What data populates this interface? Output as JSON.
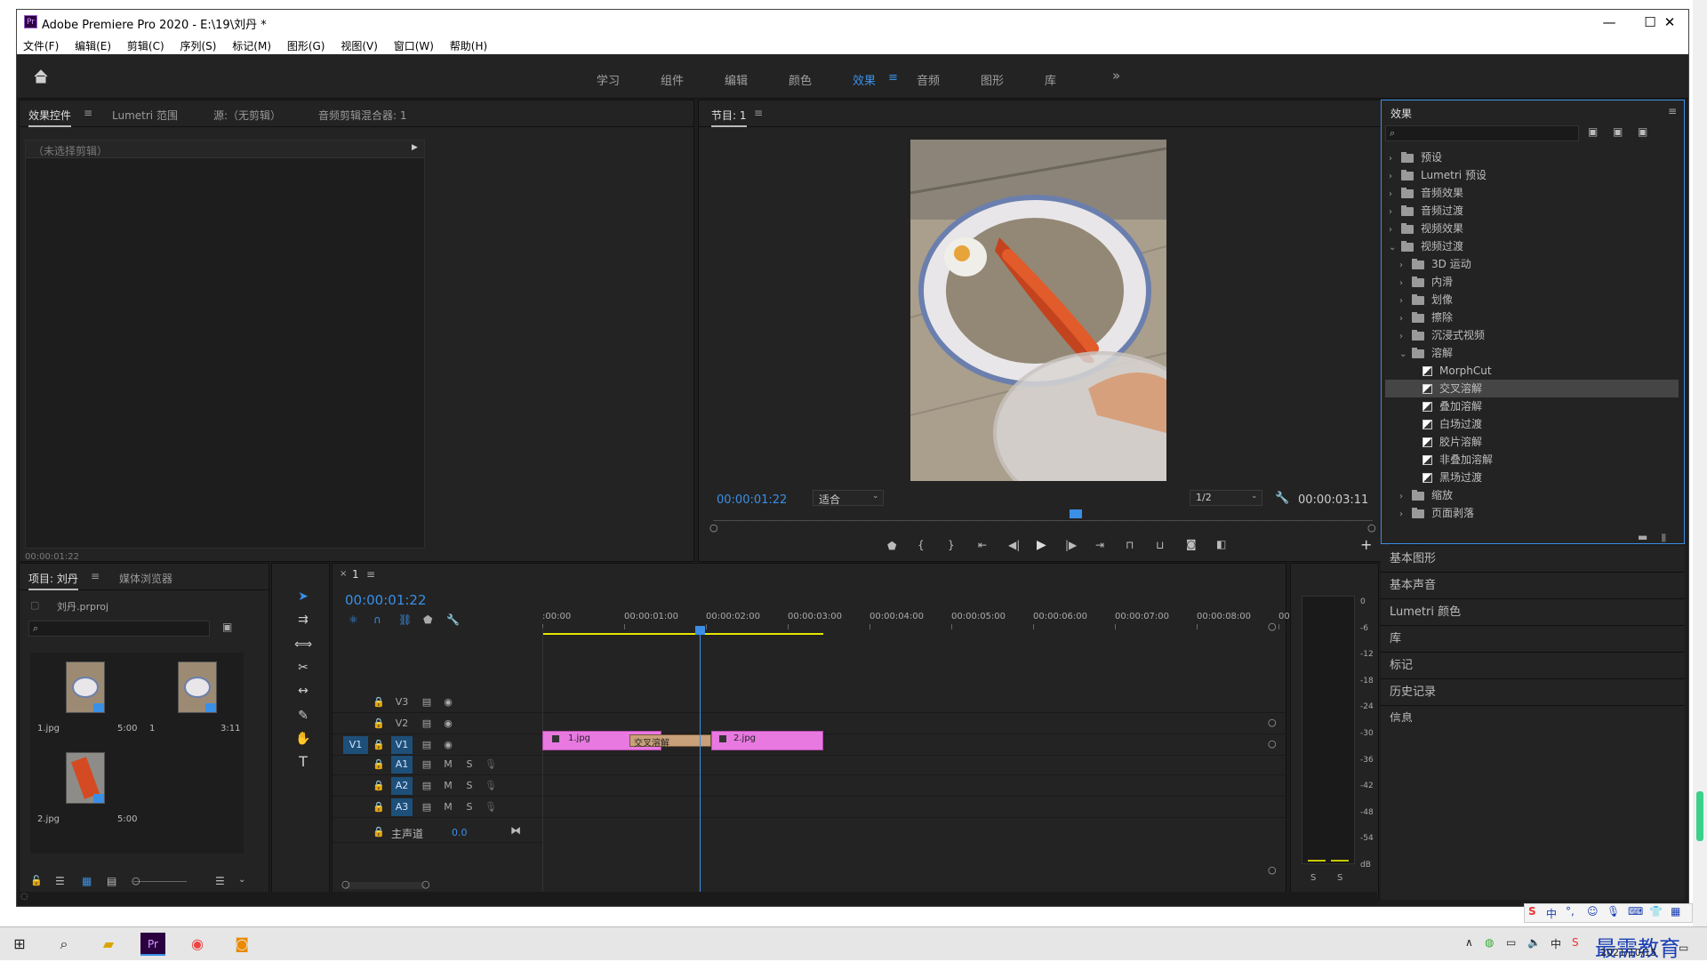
{
  "window": {
    "title": "Adobe Premiere Pro 2020 - E:\\19\\刘丹 *",
    "logo": "Pr",
    "controls": {
      "minimize": "—",
      "maximize": "☐",
      "close": "✕"
    }
  },
  "menu": [
    "文件(F)",
    "编辑(E)",
    "剪辑(C)",
    "序列(S)",
    "标记(M)",
    "图形(G)",
    "视图(V)",
    "窗口(W)",
    "帮助(H)"
  ],
  "workspaces": {
    "items": [
      "学习",
      "组件",
      "编辑",
      "颜色",
      "效果",
      "音频",
      "图形",
      "库"
    ],
    "active": "效果",
    "menu_icon": "≡",
    "overflow": "»"
  },
  "source_panel": {
    "tabs": [
      "效果控件",
      "Lumetri 范围",
      "源:（无剪辑）",
      "音频剪辑混合器: 1"
    ],
    "active_tab": "效果控件",
    "no_clip": "（未选择剪辑）",
    "timecode": "00:00:01:22"
  },
  "program": {
    "title": "节目: 1",
    "timecode": "00:00:01:22",
    "fit": "适合",
    "resolution": "1/2",
    "duration": "00:00:03:11",
    "playhead_position": 0.55
  },
  "effects_panel": {
    "title": "效果",
    "search_placeholder": "",
    "tree": [
      {
        "label": "预设",
        "level": 0,
        "type": "folder-special",
        "expanded": false
      },
      {
        "label": "Lumetri 预设",
        "level": 0,
        "type": "folder-special",
        "expanded": false
      },
      {
        "label": "音频效果",
        "level": 0,
        "type": "folder",
        "expanded": false
      },
      {
        "label": "音频过渡",
        "level": 0,
        "type": "folder",
        "expanded": false
      },
      {
        "label": "视频效果",
        "level": 0,
        "type": "folder",
        "expanded": false
      },
      {
        "label": "视频过渡",
        "level": 0,
        "type": "folder",
        "expanded": true
      },
      {
        "label": "3D 运动",
        "level": 1,
        "type": "folder",
        "expanded": false
      },
      {
        "label": "内滑",
        "level": 1,
        "type": "folder",
        "expanded": false
      },
      {
        "label": "划像",
        "level": 1,
        "type": "folder",
        "expanded": false
      },
      {
        "label": "擦除",
        "level": 1,
        "type": "folder",
        "expanded": false
      },
      {
        "label": "沉浸式视频",
        "level": 1,
        "type": "folder",
        "expanded": false
      },
      {
        "label": "溶解",
        "level": 1,
        "type": "folder",
        "expanded": true
      },
      {
        "label": "MorphCut",
        "level": 2,
        "type": "effect"
      },
      {
        "label": "交叉溶解",
        "level": 2,
        "type": "effect",
        "selected": true
      },
      {
        "label": "叠加溶解",
        "level": 2,
        "type": "effect"
      },
      {
        "label": "白场过渡",
        "level": 2,
        "type": "effect"
      },
      {
        "label": "胶片溶解",
        "level": 2,
        "type": "effect"
      },
      {
        "label": "非叠加溶解",
        "level": 2,
        "type": "effect"
      },
      {
        "label": "黑场过渡",
        "level": 2,
        "type": "effect"
      },
      {
        "label": "缩放",
        "level": 1,
        "type": "folder",
        "expanded": false
      },
      {
        "label": "页面剥落",
        "level": 1,
        "type": "folder",
        "expanded": false
      }
    ]
  },
  "side_panels": [
    "基本图形",
    "基本声音",
    "Lumetri 颜色",
    "库",
    "标记",
    "历史记录",
    "信息"
  ],
  "project": {
    "tabs": [
      "项目: 刘丹",
      "媒体浏览器"
    ],
    "file": "刘丹.prproj",
    "items": [
      {
        "name": "1.jpg",
        "duration": "5:00"
      },
      {
        "name": "1",
        "duration": "3:11"
      },
      {
        "name": "2.jpg",
        "duration": "5:00"
      }
    ]
  },
  "timeline": {
    "tab": "1",
    "timecode": "00:00:01:22",
    "ruler": [
      ":00:00",
      "00:00:01:00",
      "00:00:02:00",
      "00:00:03:00",
      "00:00:04:00",
      "00:00:05:00",
      "00:00:06:00",
      "00:00:07:00",
      "00:00:08:00",
      "00:0"
    ],
    "video_tracks": [
      "V3",
      "V2",
      "V1"
    ],
    "audio_tracks": [
      "A1",
      "A2",
      "A3"
    ],
    "source_patch": "V1",
    "master": {
      "label": "主声道",
      "value": "0.0"
    },
    "track_btn_m": "M",
    "track_btn_s": "S",
    "clips": [
      {
        "name": "1.jpg",
        "track": "V1"
      },
      {
        "name": "2.jpg",
        "track": "V1"
      }
    ],
    "transition": "交叉溶解",
    "playhead_seconds": 1.92,
    "clip_color": "#e879e0",
    "transition_color": "#c8a07a"
  },
  "meter": {
    "scale": [
      "0",
      "-6",
      "-12",
      "-18",
      "-24",
      "-30",
      "-36",
      "-42",
      "-48",
      "-54",
      "dB"
    ],
    "solo": [
      "S",
      "S"
    ]
  },
  "taskbar": {
    "ime": "中",
    "clock_time": "",
    "date": "2021/10/15",
    "watermark": "最需教育"
  },
  "colors": {
    "accent": "#3a8fe6",
    "panel": "#232323",
    "selection": "#1d4f79"
  }
}
